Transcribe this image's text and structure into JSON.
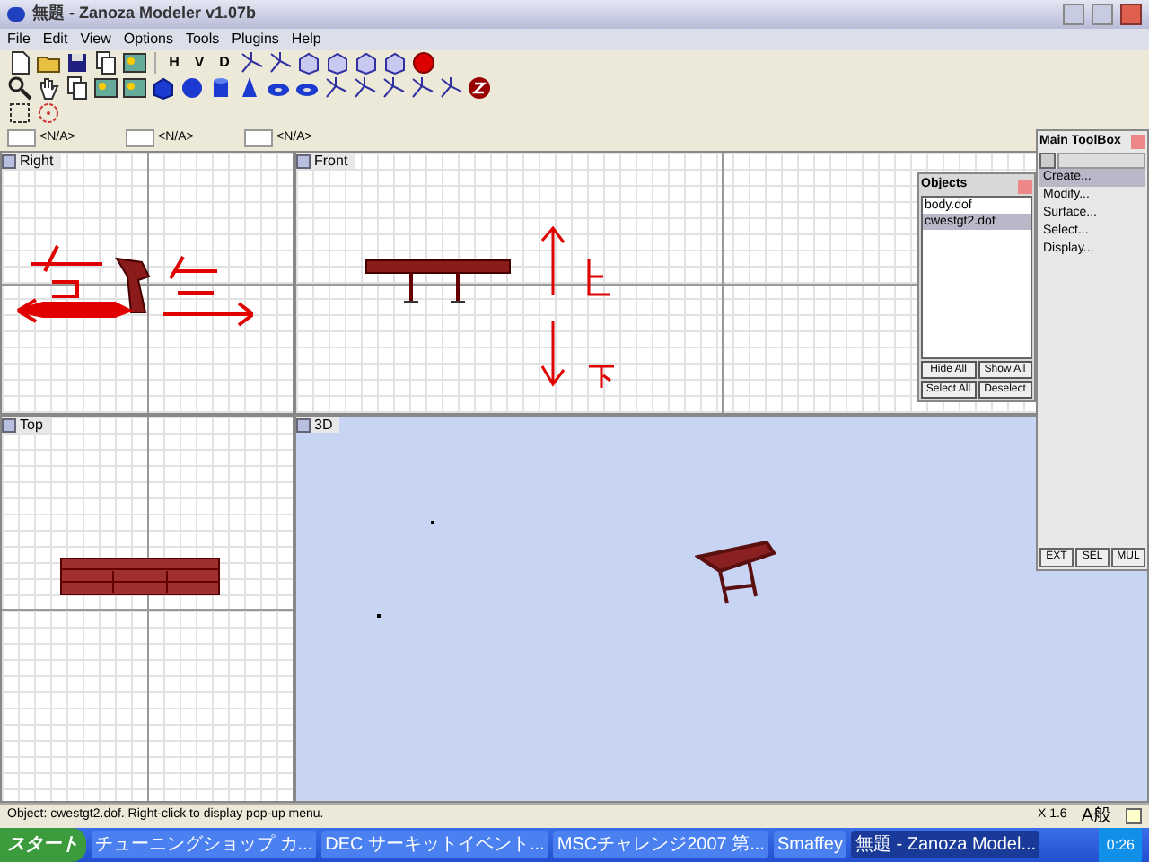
{
  "window": {
    "title": "無題 - Zanoza Modeler v1.07b"
  },
  "menu": [
    "File",
    "Edit",
    "View",
    "Options",
    "Tools",
    "Plugins",
    "Help"
  ],
  "toolbar": {
    "axis_buttons": [
      "H",
      "V",
      "D"
    ]
  },
  "spinners": [
    {
      "value": "<N/A>"
    },
    {
      "value": "<N/A>"
    },
    {
      "value": "<N/A>"
    }
  ],
  "viewports": [
    {
      "label": "Right",
      "kind": "ortho"
    },
    {
      "label": "Front",
      "kind": "ortho"
    },
    {
      "label": "Top",
      "kind": "ortho"
    },
    {
      "label": "3D",
      "kind": "perspective"
    }
  ],
  "objects_panel": {
    "title": "Objects",
    "items": [
      {
        "label": "body.dof",
        "selected": false
      },
      {
        "label": "cwestgt2.dof",
        "selected": true
      }
    ],
    "buttons": [
      "Hide All",
      "Show All",
      "Select All",
      "Deselect"
    ]
  },
  "toolbox": {
    "title": "Main ToolBox",
    "items": [
      {
        "label": "Create...",
        "selected": true
      },
      {
        "label": "Modify...",
        "selected": false
      },
      {
        "label": "Surface...",
        "selected": false
      },
      {
        "label": "Select...",
        "selected": false
      },
      {
        "label": "Display...",
        "selected": false
      }
    ],
    "buttons": [
      "EXT",
      "SEL",
      "MUL"
    ]
  },
  "status_bar": {
    "message": "Object: cwestgt2.dof. Right-click to display pop-up menu.",
    "zoom": "X 1.6",
    "ime_text": "A般"
  },
  "taskbar": {
    "start": "スタート",
    "tasks": [
      {
        "label": "チューニングショップ カ...",
        "selected": false
      },
      {
        "label": "DEC サーキットイベント...",
        "selected": false
      },
      {
        "label": "MSCチャレンジ2007 第...",
        "selected": false
      },
      {
        "label": "Smaffey",
        "selected": false
      },
      {
        "label": "無題 - Zanoza Model...",
        "selected": true
      }
    ],
    "clock": "0:26"
  }
}
